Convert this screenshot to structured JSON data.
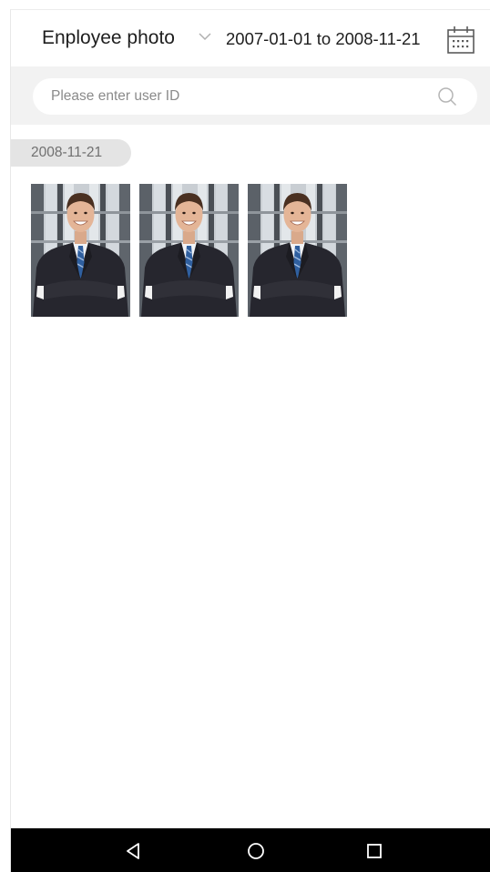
{
  "header": {
    "category_label": "Enployee photo",
    "date_range": "2007-01-01 to 2008-11-21",
    "chevron_icon": "chevron-down-icon",
    "calendar_icon": "calendar-icon"
  },
  "search": {
    "placeholder": "Please enter user ID",
    "value": "",
    "icon": "search-icon"
  },
  "groups": [
    {
      "date": "2008-11-21",
      "photos": [
        {
          "alt": "Employee photo"
        },
        {
          "alt": "Employee photo"
        },
        {
          "alt": "Employee photo"
        }
      ]
    }
  ],
  "navbar": {
    "back_icon": "back-triangle-icon",
    "home_icon": "home-circle-icon",
    "recents_icon": "recents-square-icon"
  },
  "colors": {
    "search_bar_bg": "#f2f2f2",
    "date_chip_bg": "#e4e4e4",
    "navbar_bg": "#000000"
  }
}
